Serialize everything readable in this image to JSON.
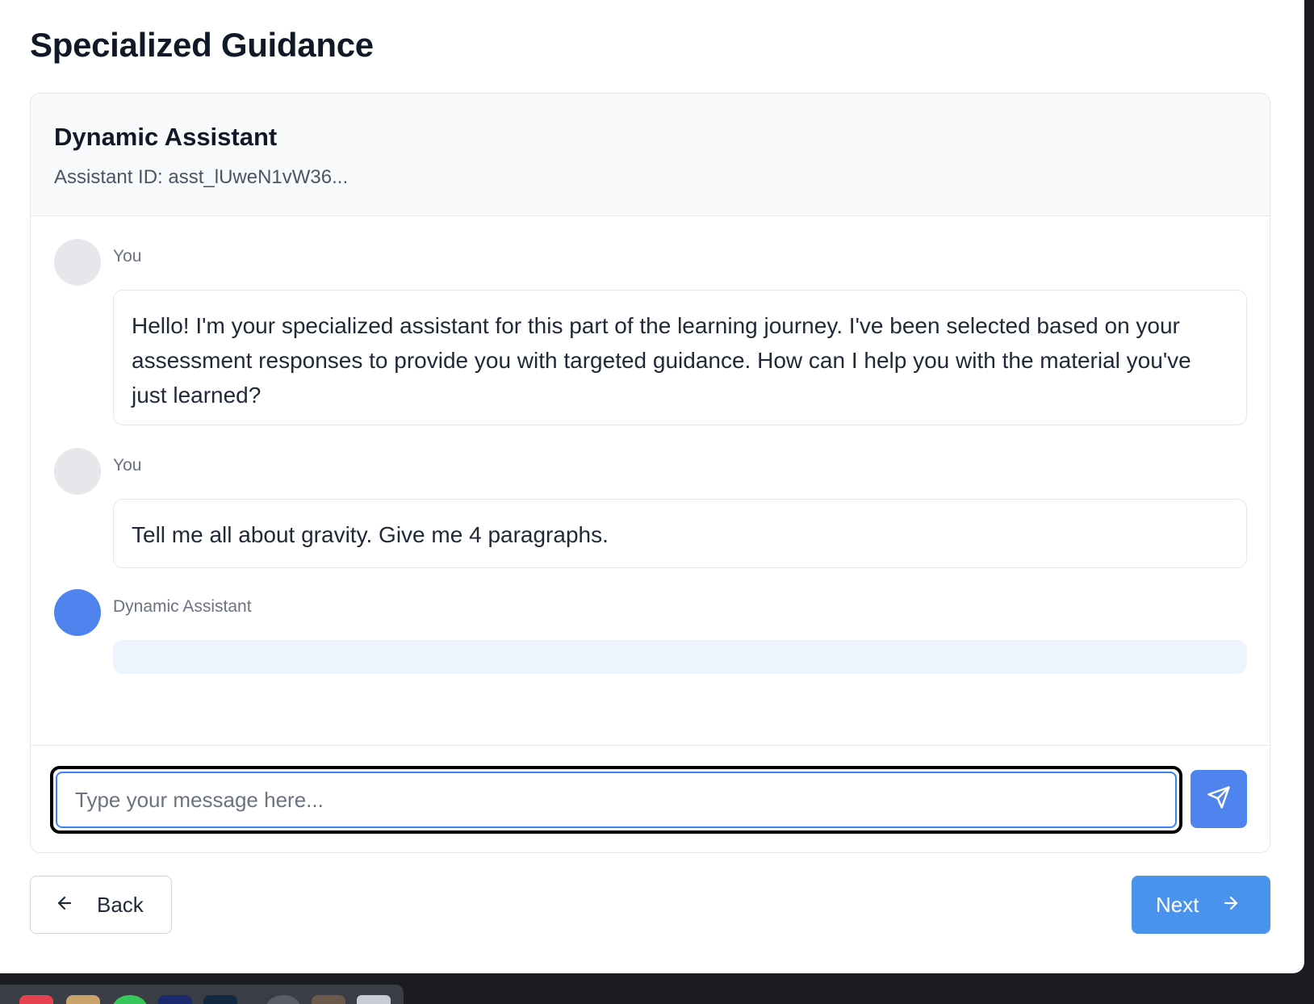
{
  "page": {
    "title": "Specialized Guidance"
  },
  "assistant": {
    "name": "Dynamic Assistant",
    "id_text": "Assistant ID: asst_lUweN1vW36..."
  },
  "messages": [
    {
      "author": "You",
      "text": "Hello! I'm your specialized assistant for this part of the learning journey. I've been selected based on your assessment responses to provide you with targeted guidance. How can I help you with the material you've just learned?"
    },
    {
      "author": "You",
      "text": "Tell me all about gravity. Give me 4 paragraphs."
    },
    {
      "author": "Dynamic Assistant",
      "text": ""
    }
  ],
  "composer": {
    "placeholder": "Type your message here...",
    "value": "",
    "send_icon": "send-icon"
  },
  "nav": {
    "back_label": "Back",
    "back_icon": "arrow-left-icon",
    "next_label": "Next",
    "next_icon": "arrow-right-icon"
  },
  "colors": {
    "accent": "#4f83ee",
    "next_button": "#4a93ec",
    "header_bg": "#f8fafc",
    "assistant_bubble": "#eef4fd",
    "focus_ring": "#000000"
  }
}
